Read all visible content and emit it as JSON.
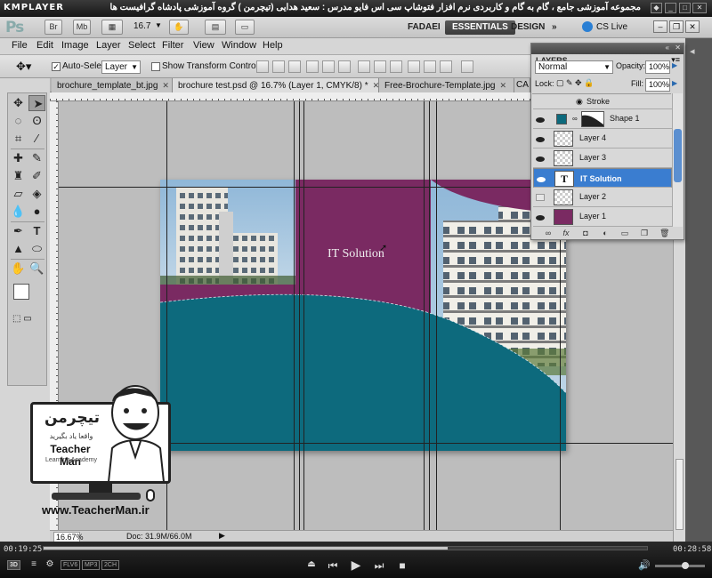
{
  "player": {
    "logo": "KMPLAYER",
    "title": "مجموعه آموزشی جامع ، گام به گام و کاربردی نرم افزار فتوشاپ سی اس فایو  مدرس : سعید هدایی (تیچرمن ) گروه آموزشی پادشاه گرافیست ها",
    "time_current": "00:19:25",
    "time_total": "00:28:58",
    "progress": 0.67,
    "badges": [
      "3D",
      "FLV6",
      "MP3",
      "2CH"
    ]
  },
  "appbar": {
    "logo": "Ps",
    "bridge": "Br",
    "minibridge": "Mb",
    "zoom": "16.7",
    "workspaces": [
      "FADAEI",
      "ESSENTIALS",
      "DESIGN",
      "»"
    ],
    "active_workspace": "ESSENTIALS",
    "cs_live": "CS Live"
  },
  "menu": [
    "File",
    "Edit",
    "Image",
    "Layer",
    "Select",
    "Filter",
    "View",
    "Window",
    "Help"
  ],
  "options": {
    "auto_select_label": "Auto-Select:",
    "auto_select_checked": true,
    "auto_select_value": "Layer",
    "show_transform_label": "Show Transform Controls",
    "show_transform_checked": false
  },
  "tabs": [
    {
      "label": "brochure_template_bt.jpg",
      "active": false
    },
    {
      "label": "brochure test.psd @ 16.7% (Layer 1, CMYK/8) *",
      "active": true
    },
    {
      "label": "Free-Brochure-Template.jpg",
      "active": false
    },
    {
      "label": "CA",
      "active": false
    }
  ],
  "document": {
    "text": "IT Solution",
    "colors": {
      "purple": "#7a2a62",
      "teal": "#0d6a7d",
      "canvas_bg": "#bdbdbd"
    }
  },
  "status": {
    "zoom": "16.67%",
    "doc": "Doc: 31.9M/66.0M"
  },
  "layers_panel": {
    "title": "LAYERS",
    "blend_mode": "Normal",
    "opacity_label": "Opacity:",
    "opacity": "100%",
    "lock_label": "Lock:",
    "fill_label": "Fill:",
    "fill": "100%",
    "effect_stroke": "Stroke",
    "layers": [
      {
        "name": "Shape 1",
        "visible": true,
        "selected": false,
        "thumb": "teal"
      },
      {
        "name": "Layer 4",
        "visible": true,
        "selected": false,
        "thumb": "transparent"
      },
      {
        "name": "Layer 3",
        "visible": true,
        "selected": false,
        "thumb": "transparent"
      },
      {
        "name": "IT Solution",
        "visible": true,
        "selected": true,
        "thumb": "type"
      },
      {
        "name": "Layer 2",
        "visible": false,
        "selected": false,
        "thumb": "transparent"
      },
      {
        "name": "Layer 1",
        "visible": true,
        "selected": false,
        "thumb": "purple"
      }
    ]
  },
  "watermark": {
    "brand_fa": "تیچرمن",
    "subtitle_fa": "واقعا یاد بگیرید",
    "brand_en": "Teacher Man",
    "tagline": "Learning Academy",
    "url": "www.TeacherMan.ir"
  }
}
